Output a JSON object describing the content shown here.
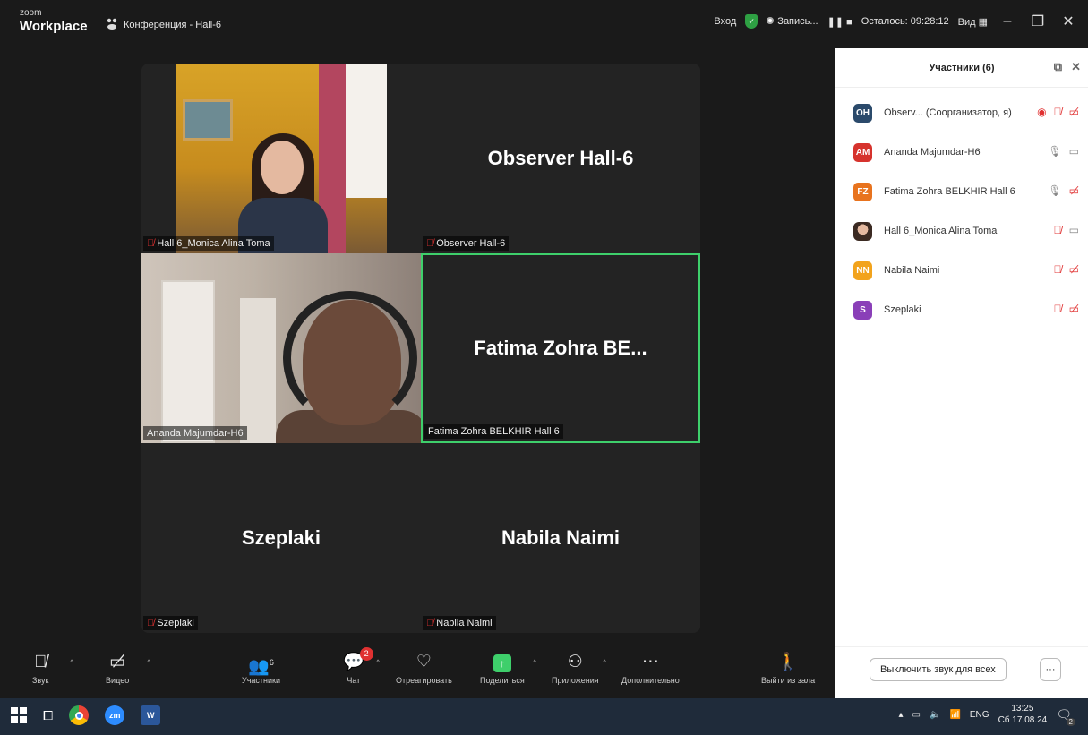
{
  "title_bar": {
    "brand_small": "zoom",
    "brand_large": "Workplace",
    "conference_title": "Конференция - Hall-6",
    "login": "Вход",
    "recording": "Запись...",
    "remaining": "Осталось: 09:28:12",
    "view": "Вид"
  },
  "tiles": [
    {
      "name": "Hall 6_Monica Alina Toma",
      "big": ""
    },
    {
      "name": "Observer Hall-6",
      "big": "Observer  Hall-6"
    },
    {
      "name": "Ananda Majumdar-H6",
      "big": ""
    },
    {
      "name": "Fatima Zohra BELKHIR Hall 6",
      "big": "Fatima Zohra BE..."
    },
    {
      "name": "Szeplaki",
      "big": "Szeplaki"
    },
    {
      "name": "Nabila Naimi",
      "big": "Nabila Naimi"
    }
  ],
  "panel": {
    "title": "Участники (6)",
    "participants": [
      {
        "initials": "OH",
        "color": "#2b4a6b",
        "name": "Observ...  (Соорганизатор, я)"
      },
      {
        "initials": "AM",
        "color": "#d6332d",
        "name": "Ananda Majumdar-H6"
      },
      {
        "initials": "FZ",
        "color": "#e8731e",
        "name": "Fatima Zohra BELKHIR Hall 6"
      },
      {
        "initials": "",
        "color": "",
        "name": "Hall 6_Monica Alina Toma"
      },
      {
        "initials": "NN",
        "color": "#f2a31c",
        "name": "Nabila Naimi"
      },
      {
        "initials": "S",
        "color": "#8a3fb8",
        "name": "Szeplaki"
      }
    ],
    "mute_all": "Выключить звук для всех",
    "more": "···"
  },
  "toolbar": {
    "audio": "Звук",
    "video": "Видео",
    "participants": "Участники",
    "participants_count": "6",
    "chat": "Чат",
    "chat_badge": "2",
    "react": "Отреагировать",
    "share": "Поделиться",
    "apps": "Приложения",
    "more": "Дополнительно",
    "leave": "Выйти из зала"
  },
  "taskbar": {
    "lang": "ENG",
    "time": "13:25",
    "date": "Сб 17.08.24",
    "notif_count": "2"
  },
  "colors": {
    "accent_green": "#3ecf6b",
    "muted_red": "#e03131"
  }
}
